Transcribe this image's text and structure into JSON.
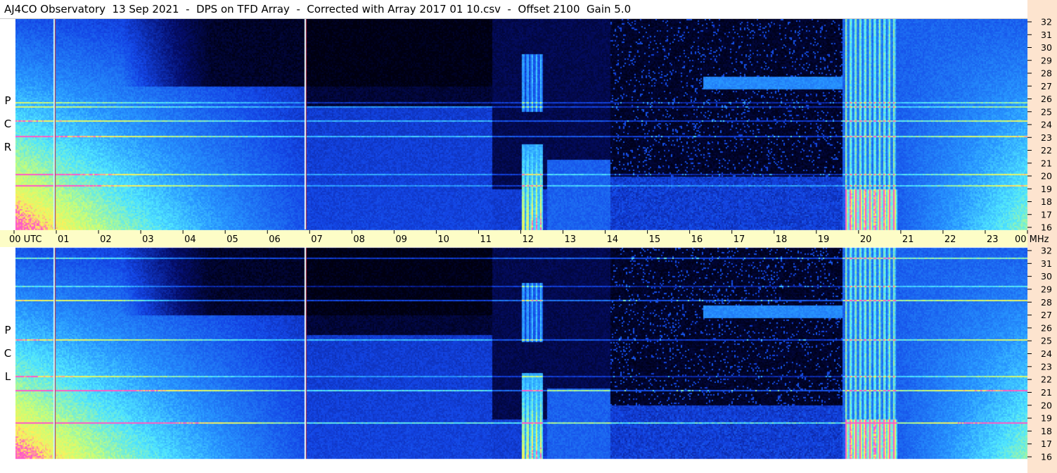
{
  "window": {
    "title": "AJ4CO Observatory  13 Sep 2021  -  DPS on TFD Array  -  Corrected with Array 2017 01 10.csv  -  Offset 2100  Gain 5.0"
  },
  "panels": [
    {
      "name": "upper-panel",
      "polarization": [
        "R",
        "C",
        "P"
      ]
    },
    {
      "name": "lower-panel",
      "polarization": [
        "L",
        "C",
        "P"
      ]
    }
  ],
  "colors": {
    "background_sky": "#000010",
    "low_intensity": "#0a1a8a",
    "mid_intensity": "#1e64ff",
    "high_intensity": "#4fe0ff",
    "saturation": "#f0ff70",
    "burst_peak": "#ff60c0",
    "time_axis_bg": "#fdfdc7",
    "freq_axis_bg": "#fde4cf"
  },
  "chart_data": {
    "type": "heatmap",
    "title": "AJ4CO Observatory  13 Sep 2021  -  DPS on TFD Array  -  Corrected with Array 2017 01 10.csv  -  Offset 2100  Gain 5.0",
    "xlabel": "UTC",
    "ylabel": "MHz",
    "x_ticks": [
      "00",
      "01",
      "02",
      "03",
      "04",
      "05",
      "06",
      "07",
      "08",
      "09",
      "10",
      "11",
      "12",
      "13",
      "14",
      "15",
      "16",
      "17",
      "18",
      "19",
      "20",
      "21",
      "22",
      "23",
      "00"
    ],
    "x_first_label": "00 UTC",
    "x_last_label": "00 MHz",
    "xlim": [
      0,
      24
    ],
    "y_ticks": [
      "16",
      "17",
      "18",
      "19",
      "20",
      "21",
      "22",
      "23",
      "24",
      "25",
      "26",
      "27",
      "28",
      "29",
      "30",
      "31",
      "32"
    ],
    "ylim": [
      16,
      32
    ],
    "panels": [
      "RCP",
      "LCP"
    ],
    "features": {
      "marker_lines_utc": [
        0.9,
        6.85
      ],
      "burst_a_utc": [
        12.0,
        12.5
      ],
      "burst_b_utc": [
        19.65,
        20.9
      ],
      "band_edge_utc": 11.3
    }
  }
}
